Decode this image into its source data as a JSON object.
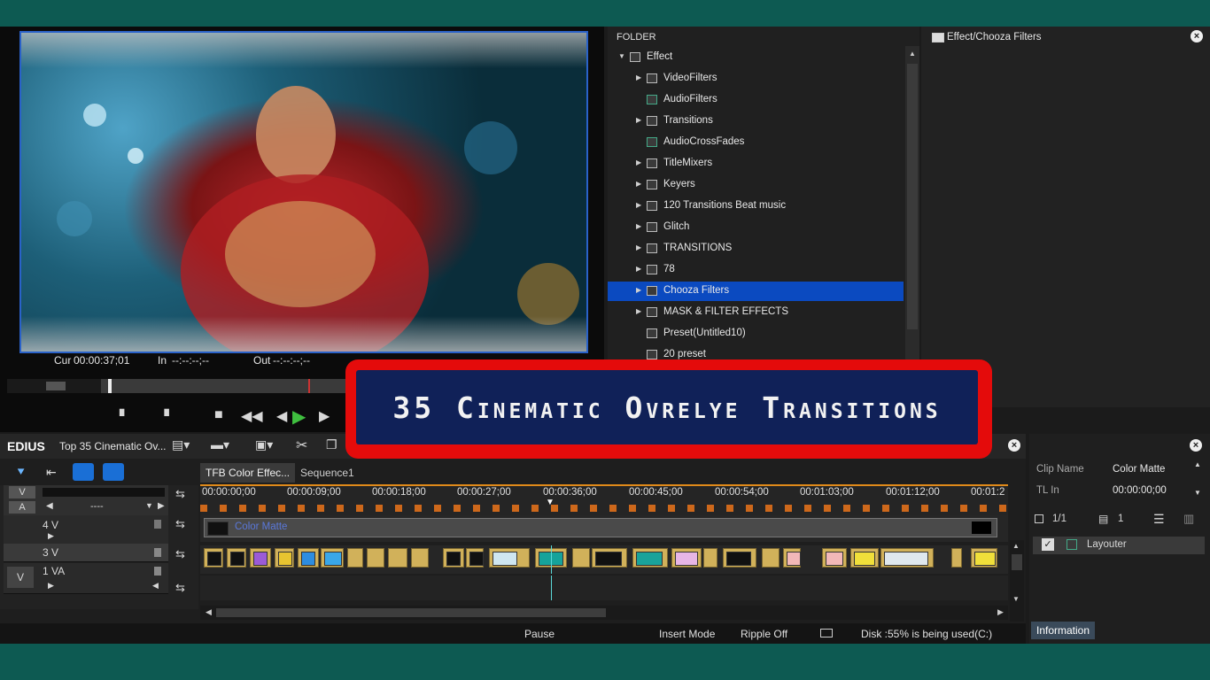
{
  "preview": {
    "cur_label": "Cur",
    "cur_value": "00:00:37;01",
    "in_label": "In",
    "in_value": "--:--:--;--",
    "out_label": "Out",
    "out_value": "--:--:--;--"
  },
  "folder": {
    "header": "FOLDER",
    "items": [
      {
        "label": "Effect"
      },
      {
        "label": "VideoFilters"
      },
      {
        "label": "AudioFilters"
      },
      {
        "label": "Transitions"
      },
      {
        "label": "AudioCrossFades"
      },
      {
        "label": "TitleMixers"
      },
      {
        "label": "Keyers"
      },
      {
        "label": "120 Transitions Beat music"
      },
      {
        "label": "Glitch"
      },
      {
        "label": "TRANSITIONS"
      },
      {
        "label": "78"
      },
      {
        "label": "Chooza Filters"
      },
      {
        "label": "MASK & FILTER EFFECTS"
      },
      {
        "label": "Preset(Untitled10)"
      },
      {
        "label": "20 preset"
      }
    ]
  },
  "effects": {
    "path": "Effect/Chooza Filters"
  },
  "banner": {
    "text": "35 Cinematic Ovrelye Transitions"
  },
  "timeline": {
    "app_name": "EDIUS",
    "project_title": "Top 35 Cinematic Ov...",
    "tabs": [
      {
        "label": "TFB Color Effec..."
      },
      {
        "label": "Sequence1"
      }
    ],
    "track_v_label": "V",
    "track_a_label": "A",
    "track_a_value": "----",
    "tracks": [
      {
        "label": "4 V"
      },
      {
        "label": "3 V"
      },
      {
        "label": "1 VA"
      }
    ],
    "track_1va_toggle": "V",
    "ruler": [
      "00:00:00;00",
      "00:00:09;00",
      "00:00:18;00",
      "00:00:27;00",
      "00:00:36;00",
      "00:00:45;00",
      "00:00:54;00",
      "00:01:03;00",
      "00:01:12;00",
      "00:01:2"
    ],
    "clip_4v_label": "Color Matte"
  },
  "status": {
    "pause": "Pause",
    "insert_mode": "Insert Mode",
    "ripple": "Ripple Off",
    "disk": "Disk :55% is being used(C:)"
  },
  "info": {
    "clip_name_label": "Clip Name",
    "clip_name_value": "Color Matte",
    "tl_in_label": "TL In",
    "tl_in_value": "00:00:00;00",
    "page": "1/1",
    "layer_count": "1",
    "layer_label": "Layouter",
    "tab_label": "Information"
  },
  "colors": {
    "selection": "#0b4ac0",
    "banner_border": "#e40b0b",
    "banner_fill": "#102158",
    "clip": "#d1b15a",
    "accent_blue": "#2a62c9"
  }
}
